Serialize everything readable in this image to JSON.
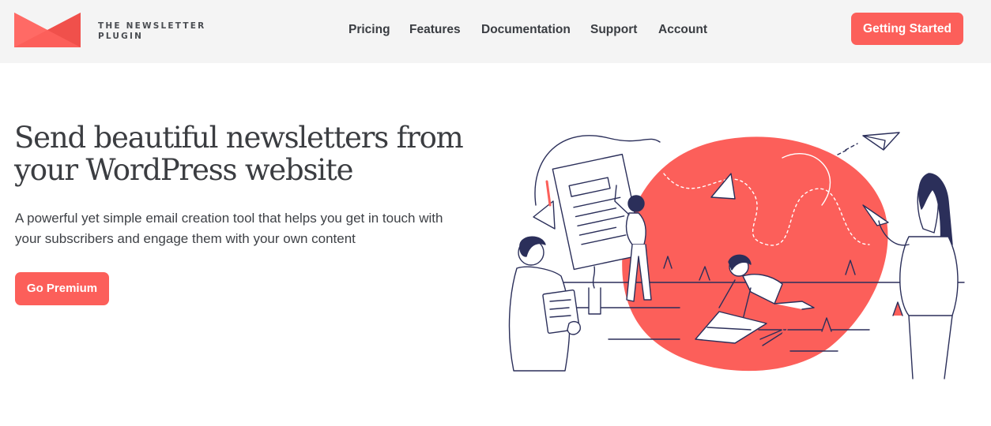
{
  "brand": {
    "line1": "THE NEWSLETTER",
    "line2": "PLUGIN",
    "logo_icon": "envelope-logo-icon",
    "accent_color": "#fc5f5a"
  },
  "nav": {
    "items": [
      {
        "label": "Pricing"
      },
      {
        "label": "Features"
      },
      {
        "label": "Documentation"
      },
      {
        "label": "Support"
      },
      {
        "label": "Account"
      }
    ],
    "cta_label": "Getting Started"
  },
  "hero": {
    "headline_line1": "Send beautiful newsletters from",
    "headline_line2": "your WordPress website",
    "subtext_line1": "A powerful yet simple email creation tool that helps you get in touch with",
    "subtext_line2": "your subscribers and engage them with your own content",
    "cta_label": "Go Premium",
    "illustration": "people-creating-newsletters-illustration"
  }
}
